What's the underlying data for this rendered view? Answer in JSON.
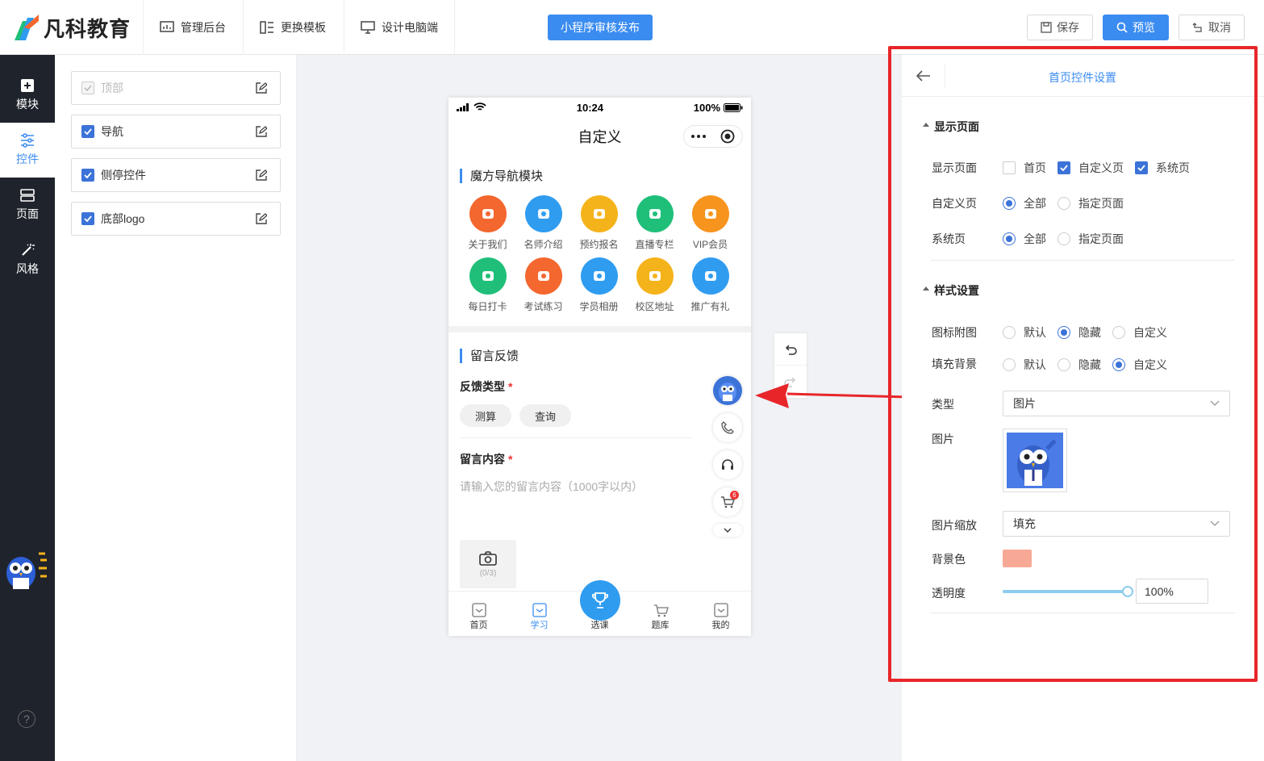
{
  "header": {
    "logo_text": "凡科教育",
    "nav": [
      "管理后台",
      "更换模板",
      "设计电脑端"
    ],
    "publish_label": "小程序审核发布",
    "save_label": "保存",
    "preview_label": "预览",
    "cancel_label": "取消"
  },
  "sidebar": {
    "items": [
      {
        "label": "模块",
        "icon": "plus-square-icon"
      },
      {
        "label": "控件",
        "icon": "sliders-icon"
      },
      {
        "label": "页面",
        "icon": "pages-icon"
      },
      {
        "label": "风格",
        "icon": "magic-wand-icon"
      }
    ],
    "active": "控件",
    "help": "?"
  },
  "controls": [
    {
      "label": "顶部",
      "state": "disabled"
    },
    {
      "label": "导航",
      "state": "checked"
    },
    {
      "label": "侧停控件",
      "state": "checked"
    },
    {
      "label": "底部logo",
      "state": "checked"
    }
  ],
  "phone": {
    "status": {
      "time": "10:24",
      "battery": "100%"
    },
    "title": "自定义",
    "nav_module_title": "魔方导航模块",
    "nav_items": [
      {
        "label": "关于我们",
        "color": "#f4672e"
      },
      {
        "label": "名师介绍",
        "color": "#2f9cf0"
      },
      {
        "label": "预约报名",
        "color": "#f5b31b"
      },
      {
        "label": "直播专栏",
        "color": "#1fbf7a"
      },
      {
        "label": "VIP会员",
        "color": "#f7941e"
      },
      {
        "label": "每日打卡",
        "color": "#1fbf7a"
      },
      {
        "label": "考试练习",
        "color": "#f4672e"
      },
      {
        "label": "学员相册",
        "color": "#2f9cf0"
      },
      {
        "label": "校区地址",
        "color": "#f5b31b"
      },
      {
        "label": "推广有礼",
        "color": "#2f9cf0"
      }
    ],
    "feedback_title": "留言反馈",
    "feedback_type_label": "反馈类型",
    "required_mark": "*",
    "feedback_types": [
      "测算",
      "查询"
    ],
    "message_label": "留言内容",
    "message_placeholder": "请输入您的留言内容（1000字以内）",
    "upload_count": "(0/3)",
    "cart_badge": "6",
    "tabs": [
      "首页",
      "学习",
      "选课",
      "题库",
      "我的"
    ],
    "active_tab": "学习"
  },
  "settings": {
    "title": "首页控件设置",
    "display_section": "显示页面",
    "display_pages_label": "显示页面",
    "display_pages": [
      {
        "label": "首页",
        "checked": false
      },
      {
        "label": "自定义页",
        "checked": true
      },
      {
        "label": "系统页",
        "checked": true
      }
    ],
    "custom_page_label": "自定义页",
    "custom_page_options": [
      "全部",
      "指定页面"
    ],
    "custom_page_selected": "全部",
    "system_page_label": "系统页",
    "system_page_options": [
      "全部",
      "指定页面"
    ],
    "system_page_selected": "全部",
    "style_section": "样式设置",
    "icon_overlay_label": "图标附图",
    "icon_overlay_options": [
      "默认",
      "隐藏",
      "自定义"
    ],
    "icon_overlay_selected": "隐藏",
    "fill_bg_label": "填充背景",
    "fill_bg_options": [
      "默认",
      "隐藏",
      "自定义"
    ],
    "fill_bg_selected": "自定义",
    "type_label": "类型",
    "type_value": "图片",
    "image_label": "图片",
    "image_scale_label": "图片缩放",
    "image_scale_value": "填充",
    "bg_color_label": "背景色",
    "bg_color": "#f8a996",
    "opacity_label": "透明度",
    "opacity_value": "100%",
    "opacity_fraction": 1.0
  },
  "colors": {
    "accent": "#3b8cf0",
    "frame": "#e8262a",
    "sidebar_bg": "#1f232b"
  }
}
